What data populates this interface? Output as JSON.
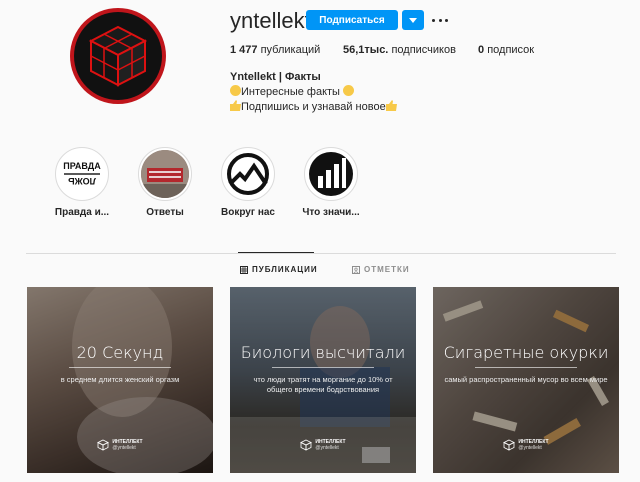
{
  "profile": {
    "username": "yntellekt",
    "follow_label": "Подписаться",
    "stats": {
      "posts_count": "1 477",
      "posts_label": "публикаций",
      "followers_count": "56,1тыс.",
      "followers_label": "подписчиков",
      "following_count": "0",
      "following_label": "подписок"
    },
    "full_name": "Yntellekt | Факты",
    "bio_line1": "Интересные факты",
    "bio_line2": "Подпишись и узнавай новое"
  },
  "highlights": [
    {
      "label": "Правда и...",
      "icon": "truth-lie-icon",
      "image_text_top": "ПРАВДА",
      "image_text_bottom": "ЛОЖЬ"
    },
    {
      "label": "Ответы",
      "icon": "answers-image"
    },
    {
      "label": "Вокруг нас",
      "icon": "mountain-circle-icon"
    },
    {
      "label": "Что значи...",
      "icon": "bars-chart-icon"
    }
  ],
  "tabs": {
    "posts": "ПУБЛИКАЦИИ",
    "tagged": "ОТМЕТКИ"
  },
  "posts": [
    {
      "title": "20 Секунд",
      "subtitle": "в среднем длится женский оргазм"
    },
    {
      "title": "Биологи высчитали",
      "subtitle": "что люди тратят на моргание до 10% от общего времени бодрствования"
    },
    {
      "title": "Сигаретные окурки",
      "subtitle": "самый распространенный мусор во всем мире"
    }
  ],
  "watermark": {
    "brand": "ИНТЕЛЛЕКТ",
    "handle": "@yntellekt"
  },
  "colors": {
    "accent": "#0095f6",
    "avatar_ring": "#c0151b"
  }
}
